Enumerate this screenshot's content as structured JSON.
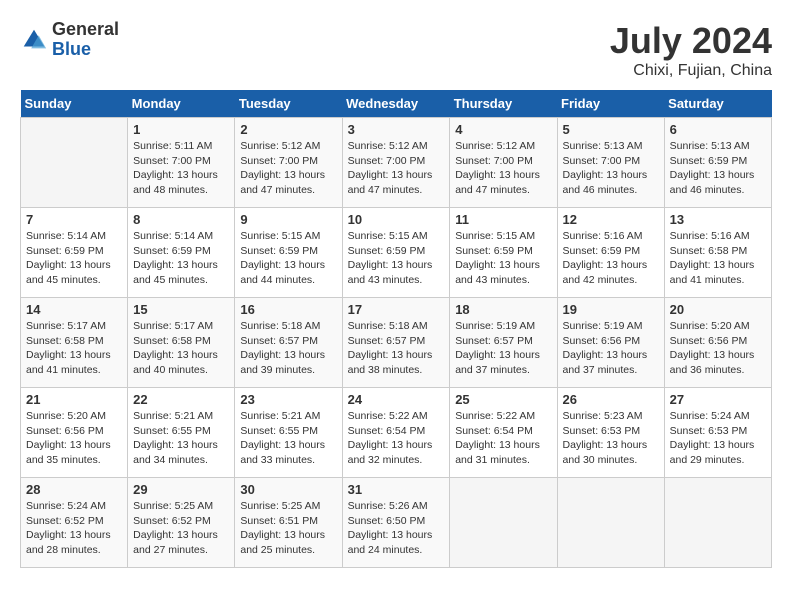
{
  "logo": {
    "general": "General",
    "blue": "Blue"
  },
  "header": {
    "title": "July 2024",
    "subtitle": "Chixi, Fujian, China"
  },
  "weekdays": [
    "Sunday",
    "Monday",
    "Tuesday",
    "Wednesday",
    "Thursday",
    "Friday",
    "Saturday"
  ],
  "weeks": [
    [
      {
        "day": "",
        "sunrise": "",
        "sunset": "",
        "daylight": ""
      },
      {
        "day": "1",
        "sunrise": "Sunrise: 5:11 AM",
        "sunset": "Sunset: 7:00 PM",
        "daylight": "Daylight: 13 hours and 48 minutes."
      },
      {
        "day": "2",
        "sunrise": "Sunrise: 5:12 AM",
        "sunset": "Sunset: 7:00 PM",
        "daylight": "Daylight: 13 hours and 47 minutes."
      },
      {
        "day": "3",
        "sunrise": "Sunrise: 5:12 AM",
        "sunset": "Sunset: 7:00 PM",
        "daylight": "Daylight: 13 hours and 47 minutes."
      },
      {
        "day": "4",
        "sunrise": "Sunrise: 5:12 AM",
        "sunset": "Sunset: 7:00 PM",
        "daylight": "Daylight: 13 hours and 47 minutes."
      },
      {
        "day": "5",
        "sunrise": "Sunrise: 5:13 AM",
        "sunset": "Sunset: 7:00 PM",
        "daylight": "Daylight: 13 hours and 46 minutes."
      },
      {
        "day": "6",
        "sunrise": "Sunrise: 5:13 AM",
        "sunset": "Sunset: 6:59 PM",
        "daylight": "Daylight: 13 hours and 46 minutes."
      }
    ],
    [
      {
        "day": "7",
        "sunrise": "Sunrise: 5:14 AM",
        "sunset": "Sunset: 6:59 PM",
        "daylight": "Daylight: 13 hours and 45 minutes."
      },
      {
        "day": "8",
        "sunrise": "Sunrise: 5:14 AM",
        "sunset": "Sunset: 6:59 PM",
        "daylight": "Daylight: 13 hours and 45 minutes."
      },
      {
        "day": "9",
        "sunrise": "Sunrise: 5:15 AM",
        "sunset": "Sunset: 6:59 PM",
        "daylight": "Daylight: 13 hours and 44 minutes."
      },
      {
        "day": "10",
        "sunrise": "Sunrise: 5:15 AM",
        "sunset": "Sunset: 6:59 PM",
        "daylight": "Daylight: 13 hours and 43 minutes."
      },
      {
        "day": "11",
        "sunrise": "Sunrise: 5:15 AM",
        "sunset": "Sunset: 6:59 PM",
        "daylight": "Daylight: 13 hours and 43 minutes."
      },
      {
        "day": "12",
        "sunrise": "Sunrise: 5:16 AM",
        "sunset": "Sunset: 6:59 PM",
        "daylight": "Daylight: 13 hours and 42 minutes."
      },
      {
        "day": "13",
        "sunrise": "Sunrise: 5:16 AM",
        "sunset": "Sunset: 6:58 PM",
        "daylight": "Daylight: 13 hours and 41 minutes."
      }
    ],
    [
      {
        "day": "14",
        "sunrise": "Sunrise: 5:17 AM",
        "sunset": "Sunset: 6:58 PM",
        "daylight": "Daylight: 13 hours and 41 minutes."
      },
      {
        "day": "15",
        "sunrise": "Sunrise: 5:17 AM",
        "sunset": "Sunset: 6:58 PM",
        "daylight": "Daylight: 13 hours and 40 minutes."
      },
      {
        "day": "16",
        "sunrise": "Sunrise: 5:18 AM",
        "sunset": "Sunset: 6:57 PM",
        "daylight": "Daylight: 13 hours and 39 minutes."
      },
      {
        "day": "17",
        "sunrise": "Sunrise: 5:18 AM",
        "sunset": "Sunset: 6:57 PM",
        "daylight": "Daylight: 13 hours and 38 minutes."
      },
      {
        "day": "18",
        "sunrise": "Sunrise: 5:19 AM",
        "sunset": "Sunset: 6:57 PM",
        "daylight": "Daylight: 13 hours and 37 minutes."
      },
      {
        "day": "19",
        "sunrise": "Sunrise: 5:19 AM",
        "sunset": "Sunset: 6:56 PM",
        "daylight": "Daylight: 13 hours and 37 minutes."
      },
      {
        "day": "20",
        "sunrise": "Sunrise: 5:20 AM",
        "sunset": "Sunset: 6:56 PM",
        "daylight": "Daylight: 13 hours and 36 minutes."
      }
    ],
    [
      {
        "day": "21",
        "sunrise": "Sunrise: 5:20 AM",
        "sunset": "Sunset: 6:56 PM",
        "daylight": "Daylight: 13 hours and 35 minutes."
      },
      {
        "day": "22",
        "sunrise": "Sunrise: 5:21 AM",
        "sunset": "Sunset: 6:55 PM",
        "daylight": "Daylight: 13 hours and 34 minutes."
      },
      {
        "day": "23",
        "sunrise": "Sunrise: 5:21 AM",
        "sunset": "Sunset: 6:55 PM",
        "daylight": "Daylight: 13 hours and 33 minutes."
      },
      {
        "day": "24",
        "sunrise": "Sunrise: 5:22 AM",
        "sunset": "Sunset: 6:54 PM",
        "daylight": "Daylight: 13 hours and 32 minutes."
      },
      {
        "day": "25",
        "sunrise": "Sunrise: 5:22 AM",
        "sunset": "Sunset: 6:54 PM",
        "daylight": "Daylight: 13 hours and 31 minutes."
      },
      {
        "day": "26",
        "sunrise": "Sunrise: 5:23 AM",
        "sunset": "Sunset: 6:53 PM",
        "daylight": "Daylight: 13 hours and 30 minutes."
      },
      {
        "day": "27",
        "sunrise": "Sunrise: 5:24 AM",
        "sunset": "Sunset: 6:53 PM",
        "daylight": "Daylight: 13 hours and 29 minutes."
      }
    ],
    [
      {
        "day": "28",
        "sunrise": "Sunrise: 5:24 AM",
        "sunset": "Sunset: 6:52 PM",
        "daylight": "Daylight: 13 hours and 28 minutes."
      },
      {
        "day": "29",
        "sunrise": "Sunrise: 5:25 AM",
        "sunset": "Sunset: 6:52 PM",
        "daylight": "Daylight: 13 hours and 27 minutes."
      },
      {
        "day": "30",
        "sunrise": "Sunrise: 5:25 AM",
        "sunset": "Sunset: 6:51 PM",
        "daylight": "Daylight: 13 hours and 25 minutes."
      },
      {
        "day": "31",
        "sunrise": "Sunrise: 5:26 AM",
        "sunset": "Sunset: 6:50 PM",
        "daylight": "Daylight: 13 hours and 24 minutes."
      },
      {
        "day": "",
        "sunrise": "",
        "sunset": "",
        "daylight": ""
      },
      {
        "day": "",
        "sunrise": "",
        "sunset": "",
        "daylight": ""
      },
      {
        "day": "",
        "sunrise": "",
        "sunset": "",
        "daylight": ""
      }
    ]
  ]
}
